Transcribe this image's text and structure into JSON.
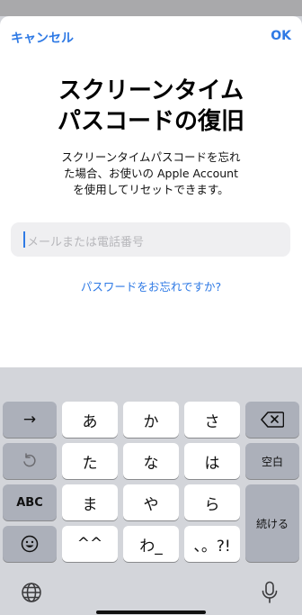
{
  "sheet": {
    "cancel_label": "キャンセル",
    "ok_label": "OK",
    "title_line1": "スクリーンタイム",
    "title_line2": "パスコードの復旧",
    "desc_line1": "スクリーンタイムパスコードを忘れ",
    "desc_line2": "た場合、お使いの Apple Account",
    "desc_line3": "を使用してリセットできます。",
    "input": {
      "value": "",
      "placeholder": "メールまたは電話番号"
    },
    "forgot_link": "パスワードをお忘れですか?"
  },
  "keyboard": {
    "row1": [
      "→",
      "あ",
      "か",
      "さ",
      "⌫"
    ],
    "row2": [
      "↺",
      "た",
      "な",
      "は",
      "空白"
    ],
    "row3": [
      "ABC",
      "ま",
      "や",
      "ら"
    ],
    "row4": [
      "☺",
      "^^",
      "わ_",
      "、。?!"
    ],
    "return_label": "続ける",
    "bottom_left_icon": "globe-icon",
    "bottom_right_icon": "microphone-icon"
  },
  "colors": {
    "accent": "#2f7ae5",
    "keyboard_bg": "#d3d5da",
    "key_dark": "#acb0ba"
  }
}
